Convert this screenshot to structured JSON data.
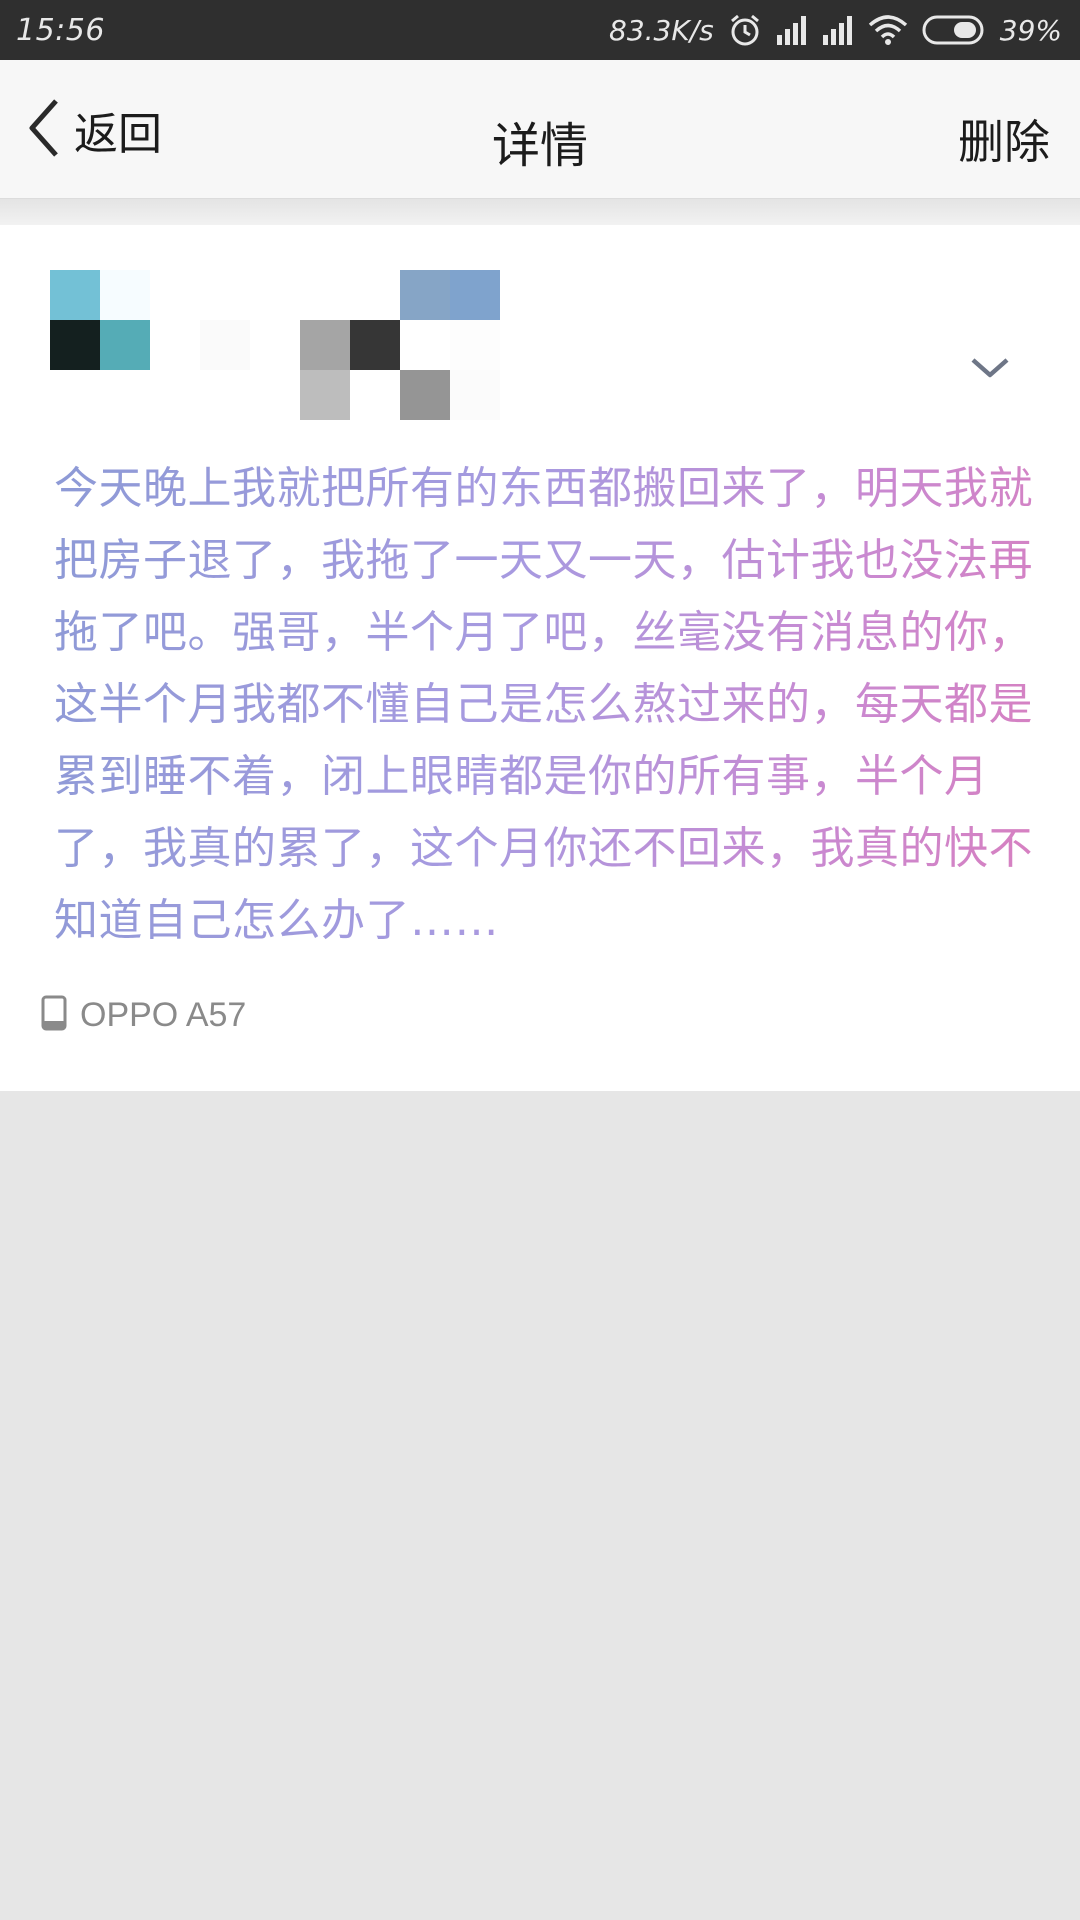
{
  "status_bar": {
    "time": "15:56",
    "net_speed": "83.3K/s",
    "battery_percent": "39%",
    "icons": [
      "alarm-icon",
      "signal-icon",
      "signal-icon",
      "wifi-icon",
      "battery-icon"
    ]
  },
  "header": {
    "back_label": "返回",
    "title": "详情",
    "delete_label": "删除"
  },
  "post": {
    "avatar_blur_colors": [
      "#73c1d6",
      "#f6fcff",
      "#14201f",
      "#55acb6"
    ],
    "username_blur_colors": [
      "#ffffff",
      "#ffffff",
      "#86a5c6",
      "#7fa3cd",
      "#a5a5a5",
      "#363636",
      "#ffffff",
      "#fdfdfd",
      "#bdbdbd",
      "#ffffff",
      "#959595",
      "#fbfbfb"
    ],
    "text": "今天晚上我就把所有的东西都搬回来了，明天我就把房子退了，我拖了一天又一天，估计我也没法再拖了吧。强哥，半个月了吧，丝毫没有消息的你，这半个月我都不懂自己是怎么熬过来的，每天都是累到睡不着，闭上眼睛都是你的所有事，半个月了，我真的累了，这个月你还不回来，我真的快不知道自己怎么办了……",
    "text_gradient": [
      "#8d9ad6",
      "#a79ae0",
      "#c88ad2",
      "#d87fbf"
    ],
    "device": "OPPO A57"
  },
  "colors": {
    "status_bar_bg": "#2f2f2f",
    "nav_bg": "#f7f7f7",
    "page_bg": "#e6e6e6",
    "card_bg": "#ffffff"
  }
}
